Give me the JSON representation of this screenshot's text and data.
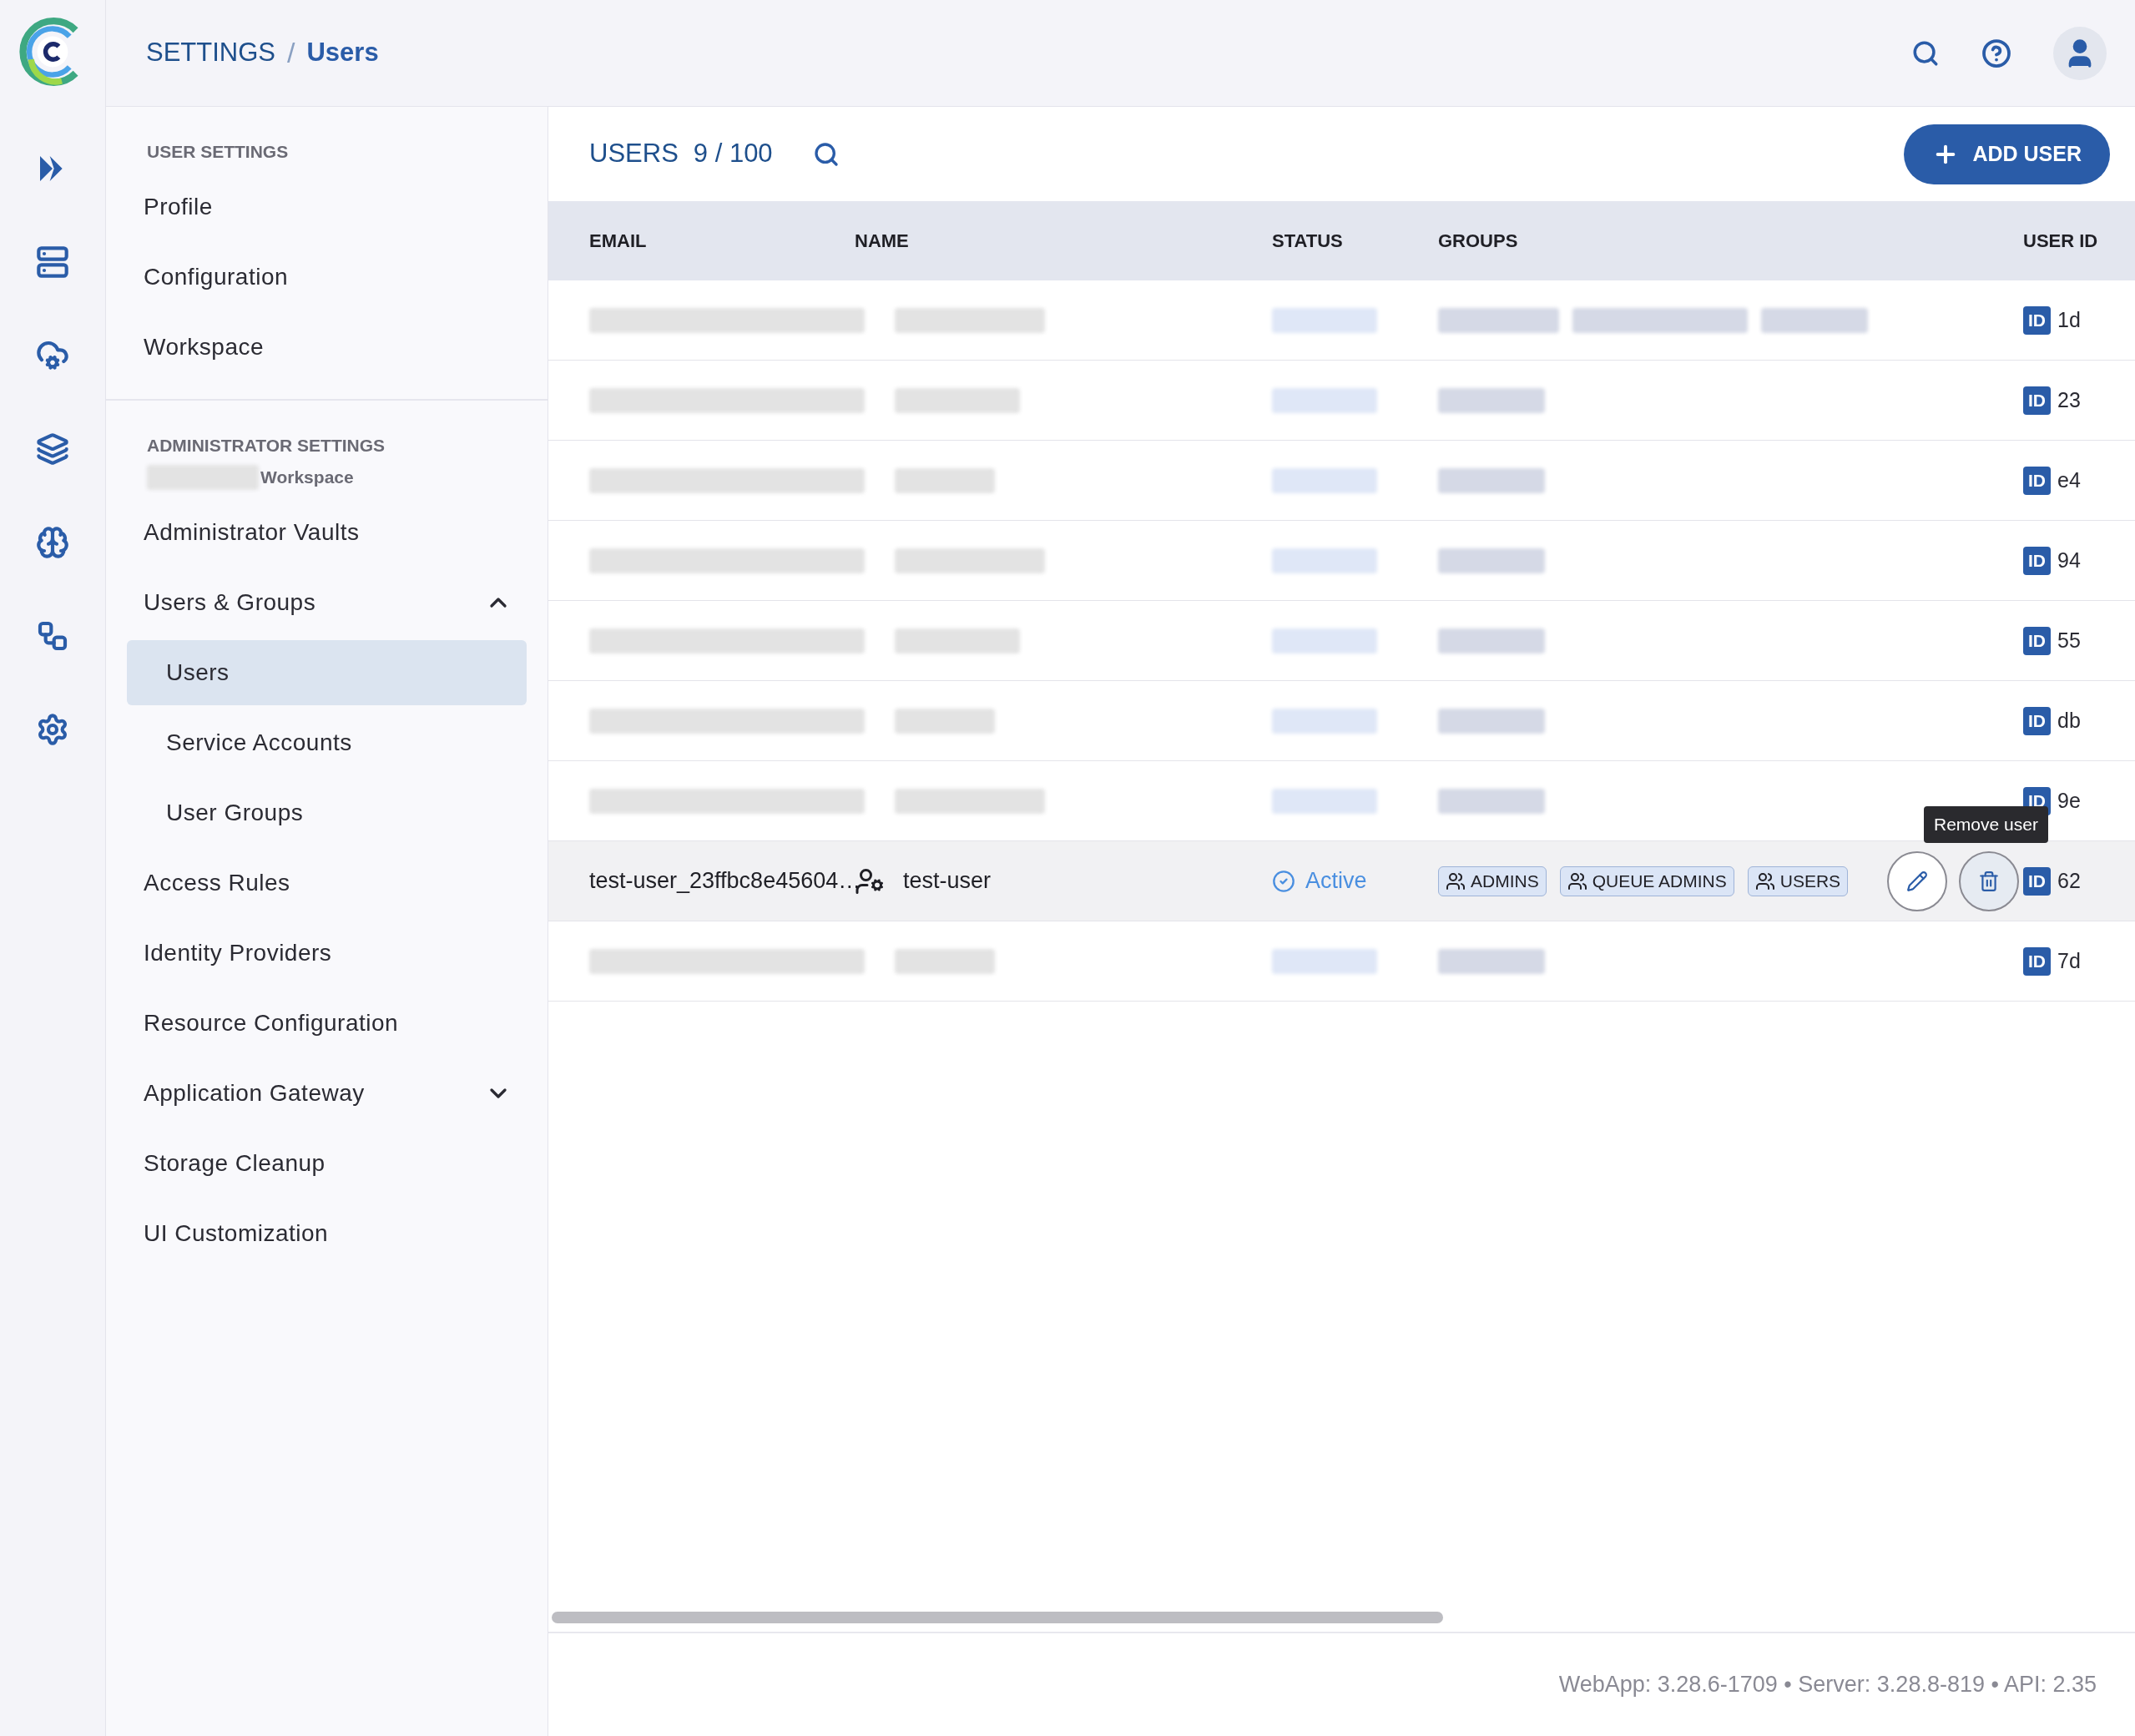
{
  "breadcrumb": {
    "section": "SETTINGS",
    "separator": "/",
    "page": "Users"
  },
  "sidebar": {
    "sections": [
      {
        "title": "USER SETTINGS",
        "items": [
          {
            "label": "Profile",
            "selected": false
          },
          {
            "label": "Configuration",
            "selected": false
          },
          {
            "label": "Workspace",
            "selected": false
          }
        ]
      },
      {
        "title": "ADMINISTRATOR SETTINGS",
        "subtitle": "Workspace",
        "items": [
          {
            "label": "Administrator Vaults",
            "selected": false
          },
          {
            "label": "Users & Groups",
            "selected": false,
            "expanded": true,
            "children": [
              {
                "label": "Users",
                "selected": true
              },
              {
                "label": "Service Accounts",
                "selected": false
              },
              {
                "label": "User Groups",
                "selected": false
              }
            ]
          },
          {
            "label": "Access Rules",
            "selected": false
          },
          {
            "label": "Identity Providers",
            "selected": false
          },
          {
            "label": "Resource Configuration",
            "selected": false
          },
          {
            "label": "Application Gateway",
            "selected": false,
            "expanded": false
          },
          {
            "label": "Storage Cleanup",
            "selected": false
          },
          {
            "label": "UI Customization",
            "selected": false
          }
        ]
      }
    ]
  },
  "header": {
    "title": "USERS",
    "count": "9 / 100",
    "add_button": "ADD USER"
  },
  "table": {
    "columns": [
      "EMAIL",
      "NAME",
      "STATUS",
      "GROUPS",
      "USER ID"
    ],
    "rows": [
      {
        "kind": "redacted",
        "hovered": false,
        "id_badge": "ID",
        "user_id": "1d"
      },
      {
        "kind": "redacted",
        "hovered": false,
        "id_badge": "ID",
        "user_id": "23"
      },
      {
        "kind": "redacted",
        "hovered": false,
        "id_badge": "ID",
        "user_id": "e4"
      },
      {
        "kind": "redacted",
        "hovered": false,
        "id_badge": "ID",
        "user_id": "94"
      },
      {
        "kind": "redacted",
        "hovered": false,
        "id_badge": "ID",
        "user_id": "55"
      },
      {
        "kind": "redacted",
        "hovered": false,
        "id_badge": "ID",
        "user_id": "db"
      },
      {
        "kind": "redacted",
        "hovered": false,
        "id_badge": "ID",
        "user_id": "9e"
      },
      {
        "kind": "user",
        "hovered": true,
        "email": "test-user_23ffbc8e45604…",
        "name": "test-user",
        "status": "Active",
        "groups": [
          "ADMINS",
          "QUEUE ADMINS",
          "USERS"
        ],
        "tooltip": "Remove user",
        "id_badge": "ID",
        "user_id": "62"
      },
      {
        "kind": "redacted",
        "hovered": false,
        "id_badge": "ID",
        "user_id": "7d"
      }
    ]
  },
  "footer": "WebApp: 3.28.6-1709 • Server: 3.28.8-819 • API: 2.35"
}
